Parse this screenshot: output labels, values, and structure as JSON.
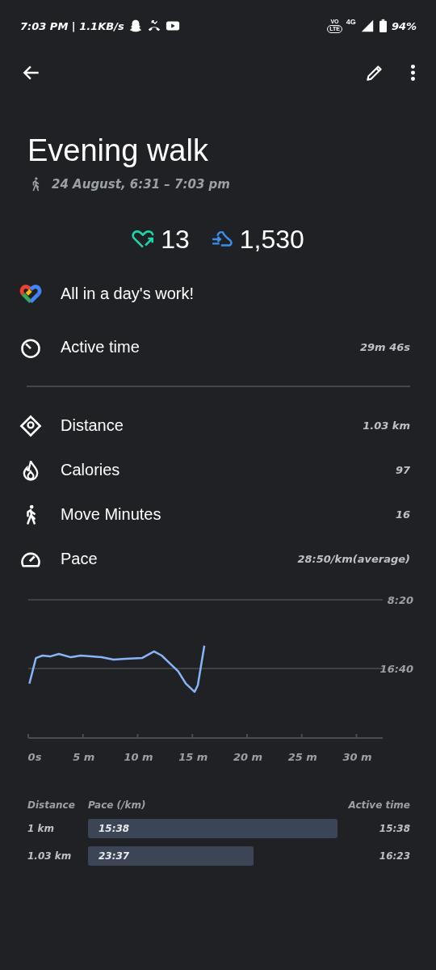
{
  "status_bar": {
    "time_speed": "7:03 PM | 1.1KB/s",
    "volte_top": "VO",
    "volte_bottom": "LTE",
    "signal_label": "4G",
    "battery": "94%"
  },
  "activity": {
    "title": "Evening walk",
    "datetime": "24 August, 6:31 – 7:03 pm"
  },
  "stats": {
    "heart_points": "13",
    "steps": "1,530"
  },
  "goal_message": "All in a day's work!",
  "active_time": {
    "label": "Active time",
    "value": "29m 46s"
  },
  "metrics": [
    {
      "label": "Distance",
      "value": "1.03 km"
    },
    {
      "label": "Calories",
      "value": "97"
    },
    {
      "label": "Move Minutes",
      "value": "16"
    },
    {
      "label": "Pace",
      "value": "28:50/km(average)"
    }
  ],
  "pace_chart": {
    "chart_data": {
      "type": "line",
      "xlim": [
        0,
        32.4
      ],
      "ylim": [
        25,
        8.33
      ],
      "xticks": [
        {
          "value": 0,
          "label": "0s"
        },
        {
          "value": 5,
          "label": "5 m"
        },
        {
          "value": 10,
          "label": "10 m"
        },
        {
          "value": 15,
          "label": "15 m"
        },
        {
          "value": 20,
          "label": "20 m"
        },
        {
          "value": 25,
          "label": "25 m"
        },
        {
          "value": 30,
          "label": "30 m"
        }
      ],
      "yticks": [
        {
          "value": 8.33,
          "label": "8:20"
        },
        {
          "value": 16.67,
          "label": "16:40"
        }
      ],
      "x": [
        0.1,
        0.7,
        1.3,
        2.0,
        2.8,
        3.9,
        4.8,
        6.7,
        7.8,
        8.9,
        10.4,
        11.5,
        12.2,
        12.9,
        13.7,
        14.4,
        15.2,
        15.5,
        16.1
      ],
      "series": [
        {
          "color": "#8ab4f8",
          "values": [
            18.5,
            15.4,
            15.1,
            15.2,
            14.9,
            15.3,
            15.1,
            15.3,
            15.6,
            15.5,
            15.4,
            14.6,
            15.1,
            16.0,
            17.0,
            18.5,
            19.5,
            18.7,
            13.9
          ]
        }
      ]
    }
  },
  "splits": {
    "columns": [
      "Distance",
      "Pace (/km)",
      "Active time"
    ],
    "rows": [
      {
        "distance": "1 km",
        "pace": "15:38",
        "active_time": "15:38"
      },
      {
        "distance": "1.03 km",
        "pace": "23:37",
        "active_time": "16:23"
      }
    ]
  }
}
